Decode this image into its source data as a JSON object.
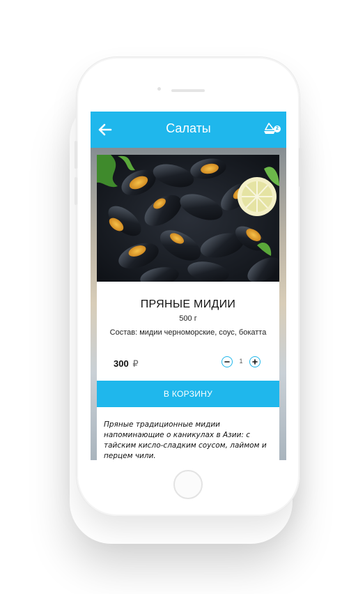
{
  "header": {
    "title": "Салаты",
    "back_icon": "arrow-left-icon",
    "cart_icon": "cart-icon",
    "cart_count": "2"
  },
  "product": {
    "image_alt": "mussels-photo",
    "name": "ПРЯНЫЕ МИДИИ",
    "weight": "500 г",
    "composition": "Состав: мидии черноморские, соус, бокатта",
    "price": "300",
    "currency": "₽",
    "quantity": "1",
    "add_to_cart_label": "В КОРЗИНУ",
    "description": "Пряные традиционные мидии напоминающие о каникулах в Азии: с тайским кисло-сладким соусом, лаймом и перцем чили."
  },
  "colors": {
    "accent": "#1fb7ec",
    "text": "#111111"
  }
}
